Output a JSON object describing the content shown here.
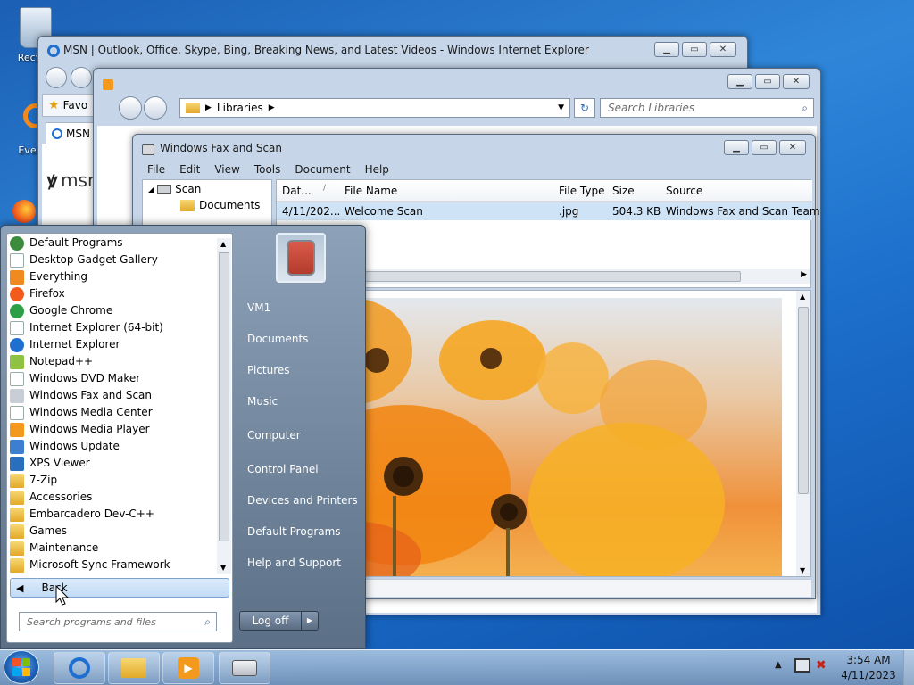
{
  "desktop": {
    "icons": [
      {
        "label": "Recyc",
        "icon": "recycle-bin-icon"
      },
      {
        "label": "Every",
        "icon": "everything-shortcut-icon"
      }
    ]
  },
  "ie_window": {
    "title": "MSN | Outlook, Office, Skype, Bing, Breaking News, and Latest Videos - Windows Internet Explorer",
    "favorites_label": "Favo",
    "tab_label": "MSN",
    "logo_text": "msn"
  },
  "explorer_window": {
    "breadcrumb": "Libraries",
    "search_placeholder": "Search Libraries"
  },
  "fax_window": {
    "title": "Windows Fax and Scan",
    "menu": [
      "File",
      "Edit",
      "View",
      "Tools",
      "Document",
      "Help"
    ],
    "tree": [
      "Scan",
      "Documents"
    ],
    "columns": [
      "Dat...",
      "File Name",
      "File Type",
      "Size",
      "Source"
    ],
    "rows": [
      {
        "date": "4/11/202...",
        "file_name": "Welcome Scan",
        "file_type": ".jpg",
        "size": "504.3 KB",
        "source": "Windows Fax and Scan Team"
      }
    ]
  },
  "start_menu": {
    "programs": [
      {
        "label": "Default Programs",
        "icon": "default-programs-icon"
      },
      {
        "label": "Desktop Gadget Gallery",
        "icon": "gadget-gallery-icon"
      },
      {
        "label": "Everything",
        "icon": "everything-icon"
      },
      {
        "label": "Firefox",
        "icon": "firefox-icon"
      },
      {
        "label": "Google Chrome",
        "icon": "chrome-icon"
      },
      {
        "label": "Internet Explorer (64-bit)",
        "icon": "ie64-icon"
      },
      {
        "label": "Internet Explorer",
        "icon": "ie-icon"
      },
      {
        "label": "Notepad++",
        "icon": "notepadpp-icon"
      },
      {
        "label": "Windows DVD Maker",
        "icon": "dvd-maker-icon"
      },
      {
        "label": "Windows Fax and Scan",
        "icon": "fax-scan-icon"
      },
      {
        "label": "Windows Media Center",
        "icon": "media-center-icon"
      },
      {
        "label": "Windows Media Player",
        "icon": "media-player-icon"
      },
      {
        "label": "Windows Update",
        "icon": "windows-update-icon"
      },
      {
        "label": "XPS Viewer",
        "icon": "xps-viewer-icon"
      },
      {
        "label": "7-Zip",
        "icon": "folder-icon"
      },
      {
        "label": "Accessories",
        "icon": "folder-icon"
      },
      {
        "label": "Embarcadero Dev-C++",
        "icon": "folder-icon"
      },
      {
        "label": "Games",
        "icon": "folder-icon"
      },
      {
        "label": "Maintenance",
        "icon": "folder-icon"
      },
      {
        "label": "Microsoft Sync Framework",
        "icon": "folder-icon"
      }
    ],
    "back_label": "Back",
    "search_placeholder": "Search programs and files",
    "right_links": [
      "VM1",
      "Documents",
      "Pictures",
      "Music",
      "Computer",
      "Control Panel",
      "Devices and Printers",
      "Default Programs",
      "Help and Support"
    ],
    "logoff_label": "Log off"
  },
  "taskbar": {
    "buttons": [
      {
        "name": "ie",
        "icon": "ie-icon"
      },
      {
        "name": "explorer",
        "icon": "file-explorer-icon"
      },
      {
        "name": "media-player",
        "icon": "media-player-icon"
      },
      {
        "name": "fax-scan",
        "icon": "fax-scan-icon"
      }
    ],
    "time": "3:54 AM",
    "date": "4/11/2023"
  },
  "colors": {
    "accent_blue": "#1c6fcb",
    "start_menu_right": "#5b6f86",
    "selected_row": "#cfe3f7"
  }
}
